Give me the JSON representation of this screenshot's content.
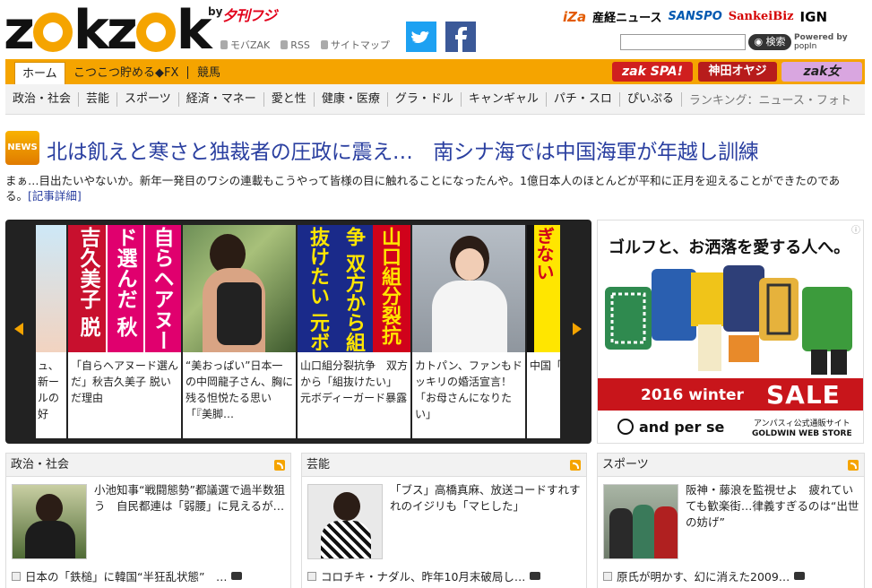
{
  "header": {
    "logo": "zakzak",
    "by": "by",
    "partner": "夕刊フジ",
    "sublinks": [
      "モバZAK",
      "RSS",
      "サイトマップ"
    ],
    "brands": [
      "iZa",
      "産経ニュース",
      "SANSPO",
      "SankeiBiz",
      "IGN"
    ],
    "search_button": "検索",
    "powered": "Powered by",
    "popin": "popIn"
  },
  "nav": {
    "tabs": [
      "ホーム",
      "こつこつ貯める◆FX",
      "競馬"
    ],
    "promos": [
      "zak SPA!",
      "神田オヤジ",
      "zak女"
    ]
  },
  "categories": [
    "政治・社会",
    "芸能",
    "スポーツ",
    "経済・マネー",
    "愛と性",
    "健康・医療",
    "グラ・ドル",
    "キャンギャル",
    "パチ・スロ",
    "ぴいぷる"
  ],
  "ranking": "ランキング：ニュース・フォト",
  "headline": {
    "badge": "NEWS",
    "title": "北は飢えと寒さと独裁者の圧政に震え…　南シナ海では中国海軍が年越し訓練",
    "lead": "まぁ…目出たいやないか。新年一発目のワシの連載もこうやって皆様の目に触れることになったんや。1億日本人のほとんどが平和に正月を迎えることができたのである。",
    "more": "[記事詳細]"
  },
  "carousel": {
    "slides": [
      {
        "caption": "ュ、新ールの好",
        "magazine": ""
      },
      {
        "caption": "「自らヘアヌード選んだ」秋吉久美子 脱いだ理由",
        "magazine": "自らヘアヌード選んだ 秋吉久美子 脱いだ理由"
      },
      {
        "caption": "“美おっぱい”日本一の中岡龍子さん、胸に残る怛悦たる思い「『美脚…",
        "magazine": ""
      },
      {
        "caption": "山口組分裂抗争　双方から「組抜けたい」　元ボディーガード暴露",
        "magazine": "山口組分裂抗争 双方から組抜けたい 元ボディーガード暴露"
      },
      {
        "caption": "カトパン、ファンもドッキリの婚活宣言！「お母さんになりたい」",
        "magazine": ""
      },
      {
        "caption": "中国「戦闘長「小い」",
        "magazine": "艦長小学生にすぎない"
      }
    ]
  },
  "ad": {
    "title": "ゴルフと、お洒落を愛する人へ。",
    "sale_year": "2016 winter",
    "sale": "SALE",
    "brand": "and per se",
    "store_line1": "アンパスィ公式通販サイト",
    "store_line2": "GOLDWIN WEB STORE",
    "adchoice": "ⓘ"
  },
  "panels": [
    {
      "title": "政治・社会",
      "caption": "小池知事“戦闘態勢”都議選で過半数狙う　自民都連は「弱腰」に見えるが…",
      "link": "日本の「鉄槌」に韓国“半狂乱状態”　…"
    },
    {
      "title": "芸能",
      "caption": "「ブス」高橋真麻、放送コードすれすれのイジリも「マヒした」",
      "link": "コロチキ・ナダル、昨年10月末破局し…"
    },
    {
      "title": "スポーツ",
      "caption": "阪神・藤浪を監視せよ　疲れていても歓楽街…律義すぎるのは“出世の妨げ”",
      "link": "原氏が明かす、幻に消えた2009…"
    }
  ],
  "colors": {
    "accent": "#f5a400",
    "headline": "#2a3fa0",
    "sale": "#c8151b"
  }
}
